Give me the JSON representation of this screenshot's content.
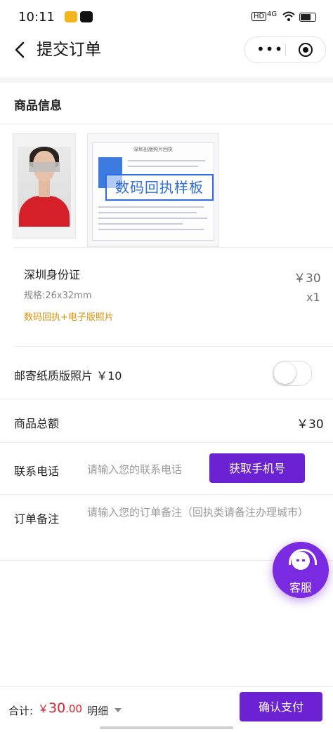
{
  "status_bar": {
    "time": "10:11",
    "hd": "HD",
    "network": "4G"
  },
  "nav": {
    "title": "提交订单",
    "dots": "•••"
  },
  "section_title": "商品信息",
  "preview": {
    "stamp_text": "数码回执样板",
    "doc_title": "深圳出版照片回执"
  },
  "product": {
    "name": "深圳身份证",
    "price": "￥30",
    "spec": "规格:26x32mm",
    "qty": "x1",
    "tag": "数码回执+电子版照片"
  },
  "mail_option": {
    "label": "邮寄纸质版照片 ￥10",
    "enabled": false
  },
  "total": {
    "label": "商品总额",
    "value": "￥30"
  },
  "phone": {
    "label": "联系电话",
    "placeholder": "请输入您的联系电话",
    "button": "获取手机号"
  },
  "remark": {
    "label": "订单备注",
    "placeholder": "请输入您的订单备注（回执类请备注办理城市）"
  },
  "service": {
    "label": "客服"
  },
  "bottom": {
    "sum_label": "合计:",
    "sum_currency": "￥",
    "sum_int": "30",
    "sum_dec": ".00",
    "detail_label": "明细",
    "pay_button": "确认支付"
  },
  "colors": {
    "accent": "#6a22d2",
    "price_red": "#e0202a",
    "tag_orange": "#e0920a"
  }
}
